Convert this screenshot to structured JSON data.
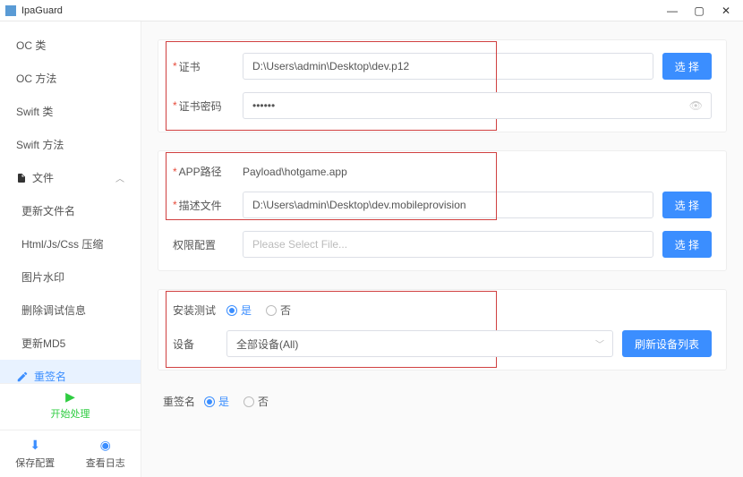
{
  "window": {
    "title": "IpaGuard"
  },
  "sidebar": {
    "items": [
      {
        "label": "OC 类"
      },
      {
        "label": "OC 方法"
      },
      {
        "label": "Swift 类"
      },
      {
        "label": "Swift 方法"
      },
      {
        "label": "文件"
      },
      {
        "label": "更新文件名"
      },
      {
        "label": "Html/Js/Css 压缩"
      },
      {
        "label": "图片水印"
      },
      {
        "label": "删除调试信息"
      },
      {
        "label": "更新MD5"
      },
      {
        "label": "重签名"
      }
    ],
    "start": "开始处理",
    "save": "保存配置",
    "logs": "查看日志"
  },
  "cert": {
    "label": "证书",
    "value": "D:\\Users\\admin\\Desktop\\dev.p12",
    "pwd_label": "证书密码",
    "pwd_value": "••••••",
    "select": "选 择"
  },
  "app": {
    "path_label": "APP路径",
    "path_value": "Payload\\hotgame.app",
    "prov_label": "描述文件",
    "prov_value": "D:\\Users\\admin\\Desktop\\dev.mobileprovision",
    "perm_label": "权限配置",
    "perm_placeholder": "Please Select File...",
    "select": "选 择"
  },
  "install": {
    "test_label": "安装测试",
    "yes": "是",
    "no": "否",
    "device_label": "设备",
    "device_value": "全部设备(All)",
    "refresh": "刷新设备列表"
  },
  "footer": {
    "label": "重签名",
    "yes": "是",
    "no": "否"
  }
}
